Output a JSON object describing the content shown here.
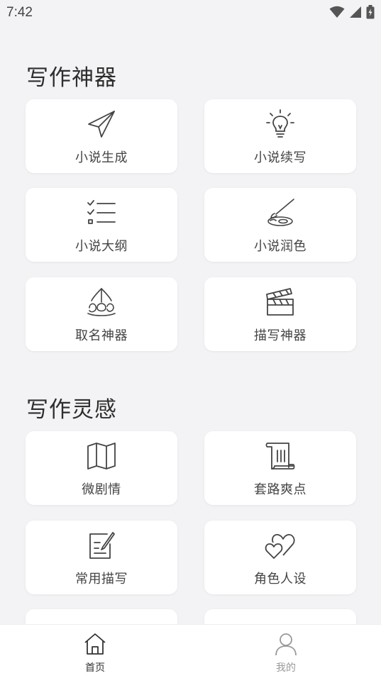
{
  "status_bar": {
    "time": "7:42",
    "icons": [
      "wifi-icon",
      "signal-icon",
      "battery-icon"
    ]
  },
  "sections": [
    {
      "title": "写作神器",
      "items": [
        {
          "label": "小说生成",
          "icon": "paper-plane-icon"
        },
        {
          "label": "小说续写",
          "icon": "lightbulb-icon"
        },
        {
          "label": "小说大纲",
          "icon": "checklist-icon"
        },
        {
          "label": "小说润色",
          "icon": "brush-palette-icon"
        },
        {
          "label": "取名神器",
          "icon": "flower-icon"
        },
        {
          "label": "描写神器",
          "icon": "clapperboard-icon"
        }
      ]
    },
    {
      "title": "写作灵感",
      "items": [
        {
          "label": "微剧情",
          "icon": "map-icon"
        },
        {
          "label": "套路爽点",
          "icon": "scroll-icon"
        },
        {
          "label": "常用描写",
          "icon": "note-edit-icon"
        },
        {
          "label": "角色人设",
          "icon": "hearts-icon"
        }
      ]
    }
  ],
  "bottom_nav": {
    "items": [
      {
        "label": "首页",
        "icon": "home-icon",
        "active": true
      },
      {
        "label": "我的",
        "icon": "user-icon",
        "active": false
      }
    ],
    "active_color": "#333333",
    "inactive_color": "#999999"
  },
  "colors": {
    "background": "#f3f3f5",
    "card": "#ffffff",
    "text": "#333333"
  }
}
